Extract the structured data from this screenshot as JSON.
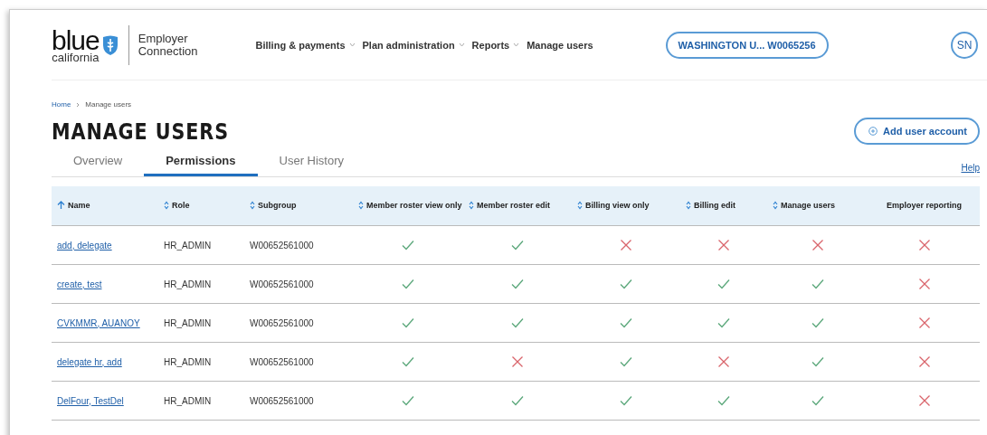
{
  "header": {
    "logo": {
      "word": "blue",
      "region": "california"
    },
    "product": [
      "Employer",
      "Connection"
    ],
    "nav": [
      {
        "label": "Billing & payments",
        "has_menu": true
      },
      {
        "label": "Plan administration",
        "has_menu": true
      },
      {
        "label": "Reports",
        "has_menu": true
      },
      {
        "label": "Manage users",
        "has_menu": false
      }
    ],
    "account": "WASHINGTON U... W0065256",
    "avatar": "SN"
  },
  "breadcrumb": [
    {
      "label": "Home",
      "link": true
    },
    {
      "label": "Manage users",
      "link": false
    }
  ],
  "title": "MANAGE USERS",
  "add_button": "Add user account",
  "help": "Help",
  "tabs": [
    {
      "label": "Overview",
      "selected": false
    },
    {
      "label": "Permissions",
      "selected": true
    },
    {
      "label": "User History",
      "selected": false
    }
  ],
  "table": {
    "columns": [
      {
        "label": "Name",
        "sortable": true,
        "sorted_ascending": true
      },
      {
        "label": "Role",
        "sortable": true,
        "sorted_ascending": false
      },
      {
        "label": "Subgroup",
        "sortable": true,
        "sorted_ascending": false
      },
      {
        "label": "Member roster view only",
        "sortable": true,
        "sorted_ascending": false
      },
      {
        "label": "Member roster edit",
        "sortable": true,
        "sorted_ascending": false
      },
      {
        "label": "Billing view only",
        "sortable": true,
        "sorted_ascending": false
      },
      {
        "label": "Billing edit",
        "sortable": true,
        "sorted_ascending": false
      },
      {
        "label": "Manage users",
        "sortable": true,
        "sorted_ascending": false
      },
      {
        "label": "Employer reporting",
        "sortable": false
      }
    ],
    "rows": [
      {
        "name": "add, delegate",
        "role": "HR_ADMIN",
        "subgroup": "W00652561000",
        "permissions": [
          true,
          true,
          false,
          false,
          false,
          false
        ]
      },
      {
        "name": "create, test",
        "role": "HR_ADMIN",
        "subgroup": "W00652561000",
        "permissions": [
          true,
          true,
          true,
          true,
          true,
          false
        ]
      },
      {
        "name": "CVKMMR, AUANOY",
        "role": "HR_ADMIN",
        "subgroup": "W00652561000",
        "permissions": [
          true,
          true,
          true,
          true,
          true,
          false
        ]
      },
      {
        "name": "delegate hr, add",
        "role": "HR_ADMIN",
        "subgroup": "W00652561000",
        "permissions": [
          true,
          false,
          true,
          false,
          true,
          false
        ]
      },
      {
        "name": "DelFour, TestDel",
        "role": "HR_ADMIN",
        "subgroup": "W00652561000",
        "permissions": [
          true,
          true,
          true,
          true,
          true,
          false
        ]
      }
    ]
  }
}
